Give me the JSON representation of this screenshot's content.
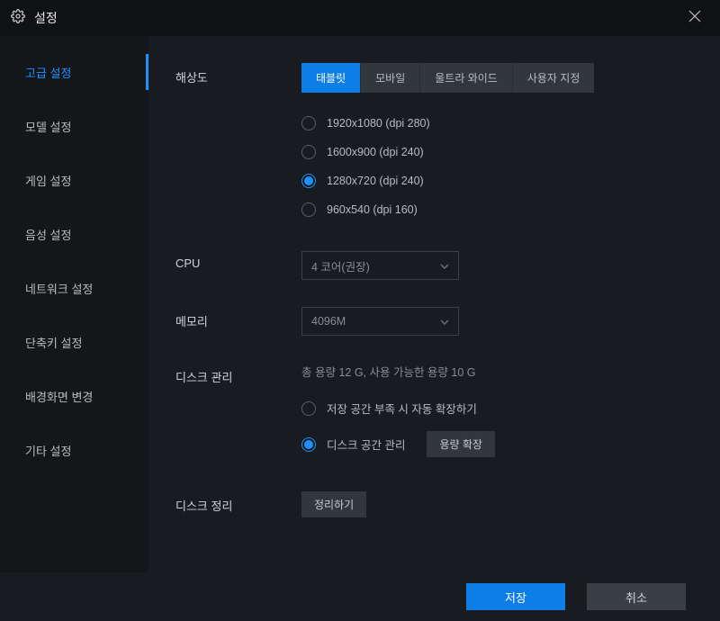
{
  "window": {
    "title": "설정"
  },
  "sidebar": {
    "items": [
      {
        "label": "고급 설정",
        "active": true
      },
      {
        "label": "모델 설정",
        "active": false
      },
      {
        "label": "게임 설정",
        "active": false
      },
      {
        "label": "음성 설정",
        "active": false
      },
      {
        "label": "네트워크 설정",
        "active": false
      },
      {
        "label": "단축키 설정",
        "active": false
      },
      {
        "label": "배경화면 변경",
        "active": false
      },
      {
        "label": "기타 설정",
        "active": false
      }
    ]
  },
  "resolution": {
    "label": "해상도",
    "tabs": [
      {
        "label": "태블릿",
        "active": true
      },
      {
        "label": "모바일",
        "active": false
      },
      {
        "label": "울트라 와이드",
        "active": false
      },
      {
        "label": "사용자 지정",
        "active": false
      }
    ],
    "options": [
      {
        "label": "1920x1080  (dpi 280)",
        "checked": false
      },
      {
        "label": "1600x900  (dpi 240)",
        "checked": false
      },
      {
        "label": "1280x720  (dpi 240)",
        "checked": true
      },
      {
        "label": "960x540  (dpi 160)",
        "checked": false
      }
    ]
  },
  "cpu": {
    "label": "CPU",
    "value": "4 코어(권장)"
  },
  "memory": {
    "label": "메모리",
    "value": "4096M"
  },
  "disk": {
    "label": "디스크 관리",
    "info": "총 용량 12 G,  사용 가능한 용량 10 G",
    "options": [
      {
        "label": "저장 공간 부족 시 자동 확장하기",
        "checked": false
      },
      {
        "label": "디스크 공간 관리",
        "checked": true
      }
    ],
    "expand_btn": "용량 확장"
  },
  "cleanup": {
    "label": "디스크 정리",
    "btn": "정리하기"
  },
  "footer": {
    "save": "저장",
    "cancel": "취소"
  }
}
